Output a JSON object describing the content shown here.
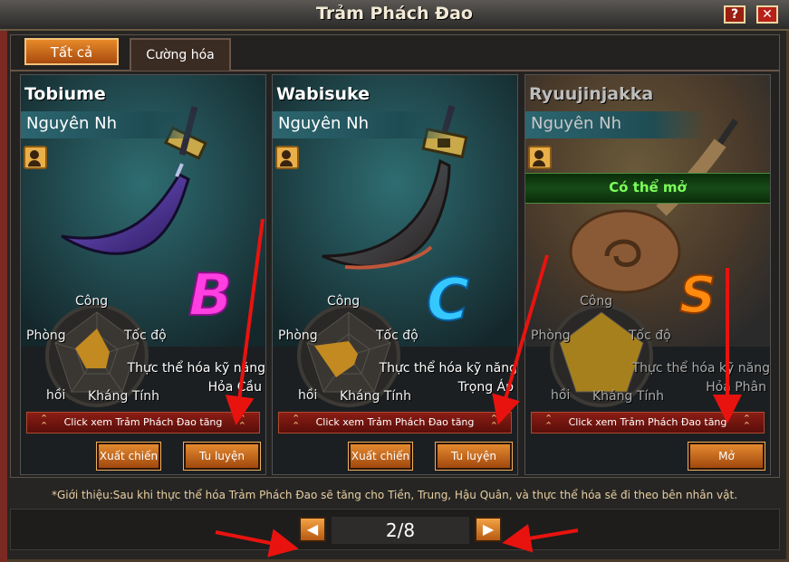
{
  "window": {
    "title": "Trảm Phách Đao",
    "help_label": "?",
    "close_label": "✕"
  },
  "tabs": [
    {
      "label": "Tất cả"
    },
    {
      "label": "Cường hóa"
    }
  ],
  "cards": [
    {
      "name": "Tobiume",
      "owner": "Nguyên Nh",
      "grade": "B",
      "stats": {
        "attack": "Công",
        "speed": "Tốc độ",
        "defense": "Phòng",
        "recover": "hồi",
        "resist": "Kháng Tính"
      },
      "skill_label": "Thực thể hóa kỹ năng",
      "skill_name": "Hỏa Cầu",
      "view_bar": "Click xem Trảm Phách Đao tăng",
      "btn1": "Xuất chiến",
      "btn2": "Tu luyện"
    },
    {
      "name": "Wabisuke",
      "owner": "Nguyên Nh",
      "grade": "C",
      "stats": {
        "attack": "Công",
        "speed": "Tốc độ",
        "defense": "Phòng",
        "recover": "hồi",
        "resist": "Kháng Tính"
      },
      "skill_label": "Thực thể hóa kỹ năng",
      "skill_name": "Trọng Áp",
      "view_bar": "Click xem Trảm Phách Đao tăng",
      "btn1": "Xuất chiến",
      "btn2": "Tu luyện"
    },
    {
      "name": "Ryuujinjakka",
      "owner": "Nguyên Nh",
      "grade": "S",
      "status": "Có thể mở",
      "stats": {
        "attack": "Công",
        "speed": "Tốc độ",
        "defense": "Phòng",
        "recover": "hồi",
        "resist": "Kháng Tính"
      },
      "skill_label": "Thực thể hóa kỹ năng",
      "skill_name": "Hỏa Phân",
      "view_bar": "Click xem Trảm Phách Đao tăng",
      "btn1": "Mở"
    }
  ],
  "intro": "*Giới thiệu:Sau khi thực thể hóa Trảm Phách Đao sẽ tăng cho Tiền, Trung, Hậu Quân, và thực thể hóa sẽ đi theo bên nhân vật.",
  "pager": {
    "current": "2/8",
    "prev_label": "◀",
    "next_label": "▶"
  },
  "colors": {
    "accent": "#e07a1c",
    "close": "#b8201a",
    "open_green": "#7cff5a",
    "arrow": "#e8130f"
  }
}
